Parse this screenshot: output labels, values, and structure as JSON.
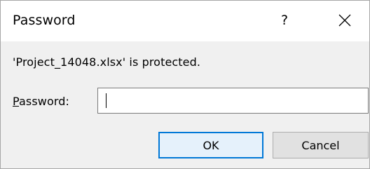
{
  "dialog": {
    "title": "Password",
    "help_glyph": "?",
    "close_icon": "close-icon",
    "message": "'Project_14048.xlsx' is protected.",
    "password_label_mnemonic": "P",
    "password_label_rest": "assword:",
    "password_value": "",
    "ok_label": "OK",
    "cancel_label": "Cancel"
  },
  "colors": {
    "accent": "#0078d7",
    "titlebar_bg": "#ffffff",
    "body_bg": "#f0f0f0",
    "button_bg": "#e1e1e1"
  }
}
